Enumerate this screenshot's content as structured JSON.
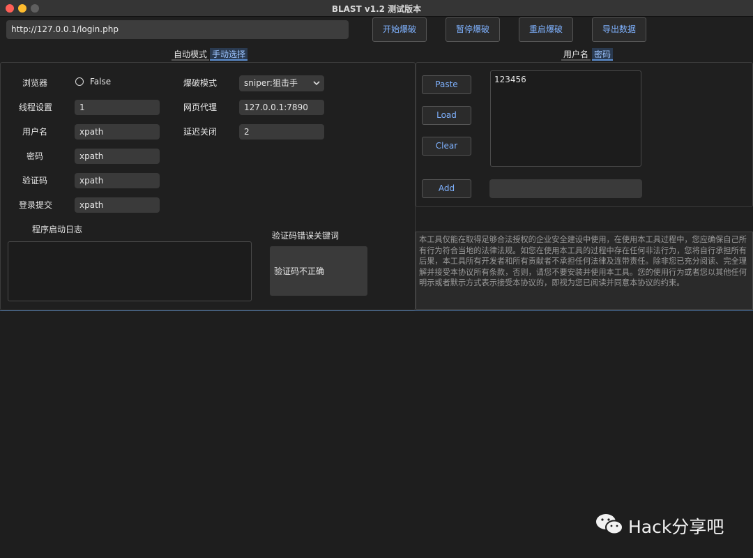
{
  "window": {
    "title": "BLAST v1.2 测试版本"
  },
  "toolbar": {
    "url_value": "http://127.0.0.1/login.php",
    "start_label": "开始爆破",
    "pause_label": "暂停爆破",
    "restart_label": "重启爆破",
    "export_label": "导出数据"
  },
  "left_tabs": {
    "auto": "自动模式",
    "manual": "手动选择"
  },
  "right_tabs": {
    "username": "用户名",
    "password": "密码"
  },
  "config": {
    "browser_label": "浏览器",
    "browser_value": "False",
    "threads_label": "线程设置",
    "threads_value": "1",
    "username_label": "用户名",
    "username_value": "xpath",
    "password_label": "密码",
    "password_value": "xpath",
    "captcha_label": "验证码",
    "captcha_value": "xpath",
    "submit_label": "登录提交",
    "submit_value": "xpath",
    "mode_label": "爆破模式",
    "mode_value": "sniper:狙击手",
    "proxy_label": "网页代理",
    "proxy_value": "127.0.0.1:7890",
    "delay_label": "延迟关闭",
    "delay_value": "2"
  },
  "log": {
    "label": "程序启动日志"
  },
  "captcha_error": {
    "label": "验证码错误关键词",
    "value": "验证码不正确"
  },
  "dict": {
    "paste_label": "Paste",
    "load_label": "Load",
    "clear_label": "Clear",
    "add_label": "Add",
    "list_text": "123456",
    "add_value": ""
  },
  "disclaimer": "本工具仅能在取得足够合法授权的企业安全建设中使用，在使用本工具过程中，您应确保自己所有行为符合当地的法律法规。如您在使用本工具的过程中存在任何非法行为，您将自行承担所有后果，本工具所有开发者和所有贡献者不承担任何法律及连带责任。除非您已充分阅读、完全理解并接受本协议所有条款，否则，请您不要安装并使用本工具。您的使用行为或者您以其他任何明示或者默示方式表示接受本协议的，即视为您已阅读并同意本协议的约束。",
  "watermark": "Hack分享吧",
  "colors": {
    "accent": "#7fb2ff",
    "close": "#ff5f57",
    "minimize": "#febc2e",
    "zoom": "#5f5f5f"
  }
}
